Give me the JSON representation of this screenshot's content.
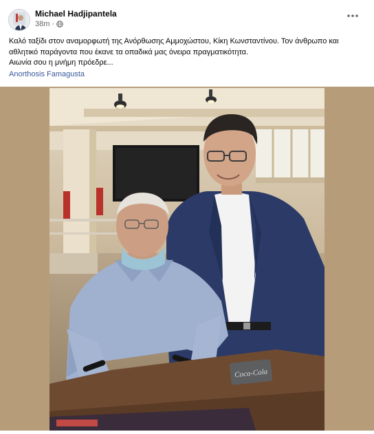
{
  "post": {
    "author": "Michael Hadjipantela",
    "time": "38m",
    "privacy_icon": "globe-icon",
    "more_icon": "more-horizontal-icon",
    "caption_lines": [
      "Καλό ταξίδι στον αναμορφωτή της Ανόρθωσης Αμμοχώστου, Κίκη Κωνσταντίνου. Τον άνθρωπο και",
      "αθλητικό παράγοντα που έκανε τα οπαδικά μας όνειρα πραγματικότητα.",
      "Αιωνία σου η μνήμη πρόεδρε..."
    ],
    "page_link": "Anorthosis Famagusta",
    "photo": {
      "description_icon": "photo-of-two-men",
      "coaster_text": "Coca-Cola"
    }
  },
  "colors": {
    "photo_frame": "#b79c79",
    "link": "#385898",
    "meta_text": "#65676b"
  }
}
